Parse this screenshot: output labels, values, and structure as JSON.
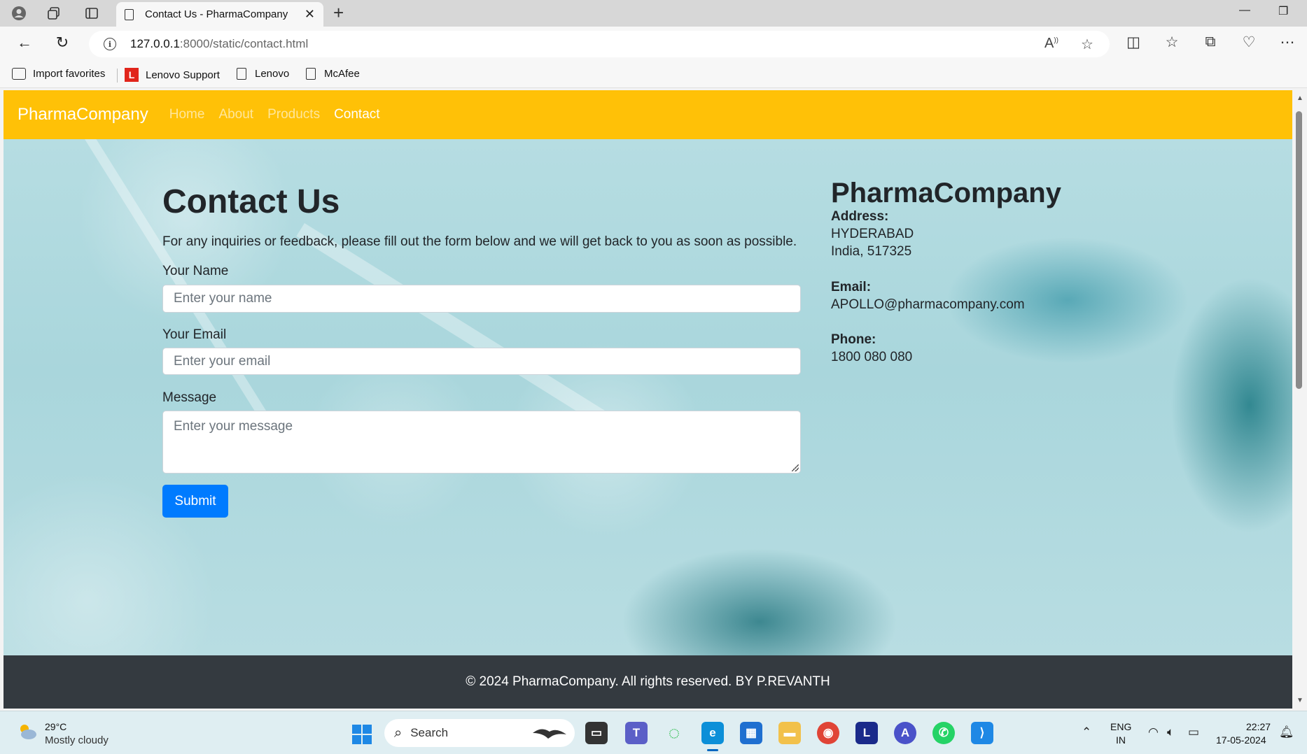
{
  "browser": {
    "tab_title": "Contact Us - PharmaCompany",
    "url_host": "127.0.0.1",
    "url_path": ":8000/static/contact.html",
    "bookmarks": [
      {
        "label": "Import favorites"
      },
      {
        "label": "Lenovo Support"
      },
      {
        "label": "Lenovo"
      },
      {
        "label": "McAfee"
      }
    ]
  },
  "navbar": {
    "brand": "PharmaCompany",
    "links": [
      {
        "label": "Home"
      },
      {
        "label": "About"
      },
      {
        "label": "Products"
      },
      {
        "label": "Contact"
      }
    ],
    "active": "Contact",
    "color": "#ffc107"
  },
  "contact": {
    "title": "Contact Us",
    "intro": "For any inquiries or feedback, please fill out the form below and we will get back to you as soon as possible.",
    "name_label": "Your Name",
    "name_placeholder": "Enter your name",
    "email_label": "Your Email",
    "email_placeholder": "Enter your email",
    "message_label": "Message",
    "message_placeholder": "Enter your message",
    "submit_label": "Submit",
    "submit_color": "#007bff"
  },
  "company_info": {
    "name": "PharmaCompany",
    "address_label": "Address:",
    "address_line1": "HYDERABAD",
    "address_line2": "India, 517325",
    "email_label": "Email:",
    "email": "APOLLO@pharmacompany.com",
    "phone_label": "Phone:",
    "phone": "1800 080 080"
  },
  "footer": {
    "text": "© 2024 PharmaCompany. All rights reserved. BY P.REVANTH",
    "color": "#343a40"
  },
  "taskbar": {
    "temperature": "29°C",
    "weather": "Mostly cloudy",
    "search_label": "Search",
    "lang_top": "ENG",
    "lang_bottom": "IN",
    "time": "22:27",
    "date": "17-05-2024"
  }
}
